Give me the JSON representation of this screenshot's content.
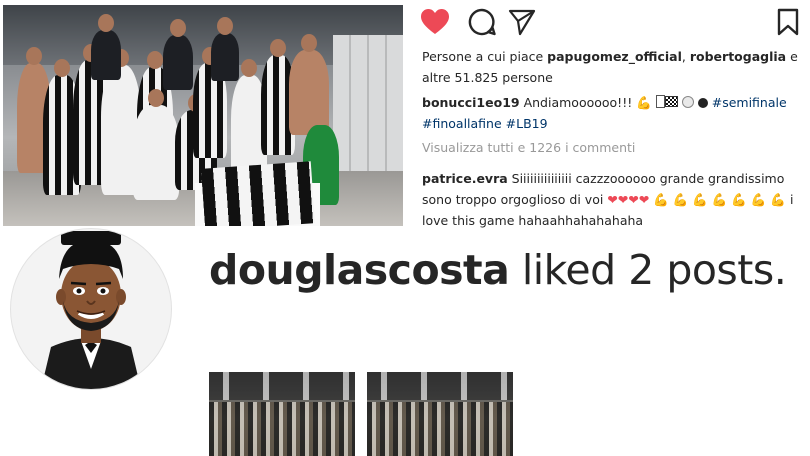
{
  "post": {
    "likes_prefix": "Persone a cui piace ",
    "liker1": "papugomez_official",
    "sep": ", ",
    "liker2": "robertogaglia",
    "likes_suffix": " e altre 51.825 persone",
    "caption_user": "bonucci1eo19",
    "caption_text": " Andiamoooooo!!! ",
    "tags": [
      "#semifinale",
      "#finoallafine",
      "#LB19"
    ],
    "view_all": "Visualizza tutti e 1226 i commenti",
    "comment_user": "patrice.evra",
    "comment_text": " Siiiiiiiiiiiiiii cazzzoooooo grande grandissimo sono troppo orgoglioso di voi ",
    "comment_hearts": "❤❤❤❤",
    "comment_arms": "💪 💪 💪 💪 💪 💪",
    "comment_tail": " i love this game hahaahhahahahaha"
  },
  "icons": {
    "like": "heart-icon",
    "comment": "comment-icon",
    "share": "paper-plane-icon",
    "save": "bookmark-icon",
    "like_color": "#ed4956"
  },
  "notification": {
    "username": "douglascosta",
    "text": " liked 2 posts."
  }
}
